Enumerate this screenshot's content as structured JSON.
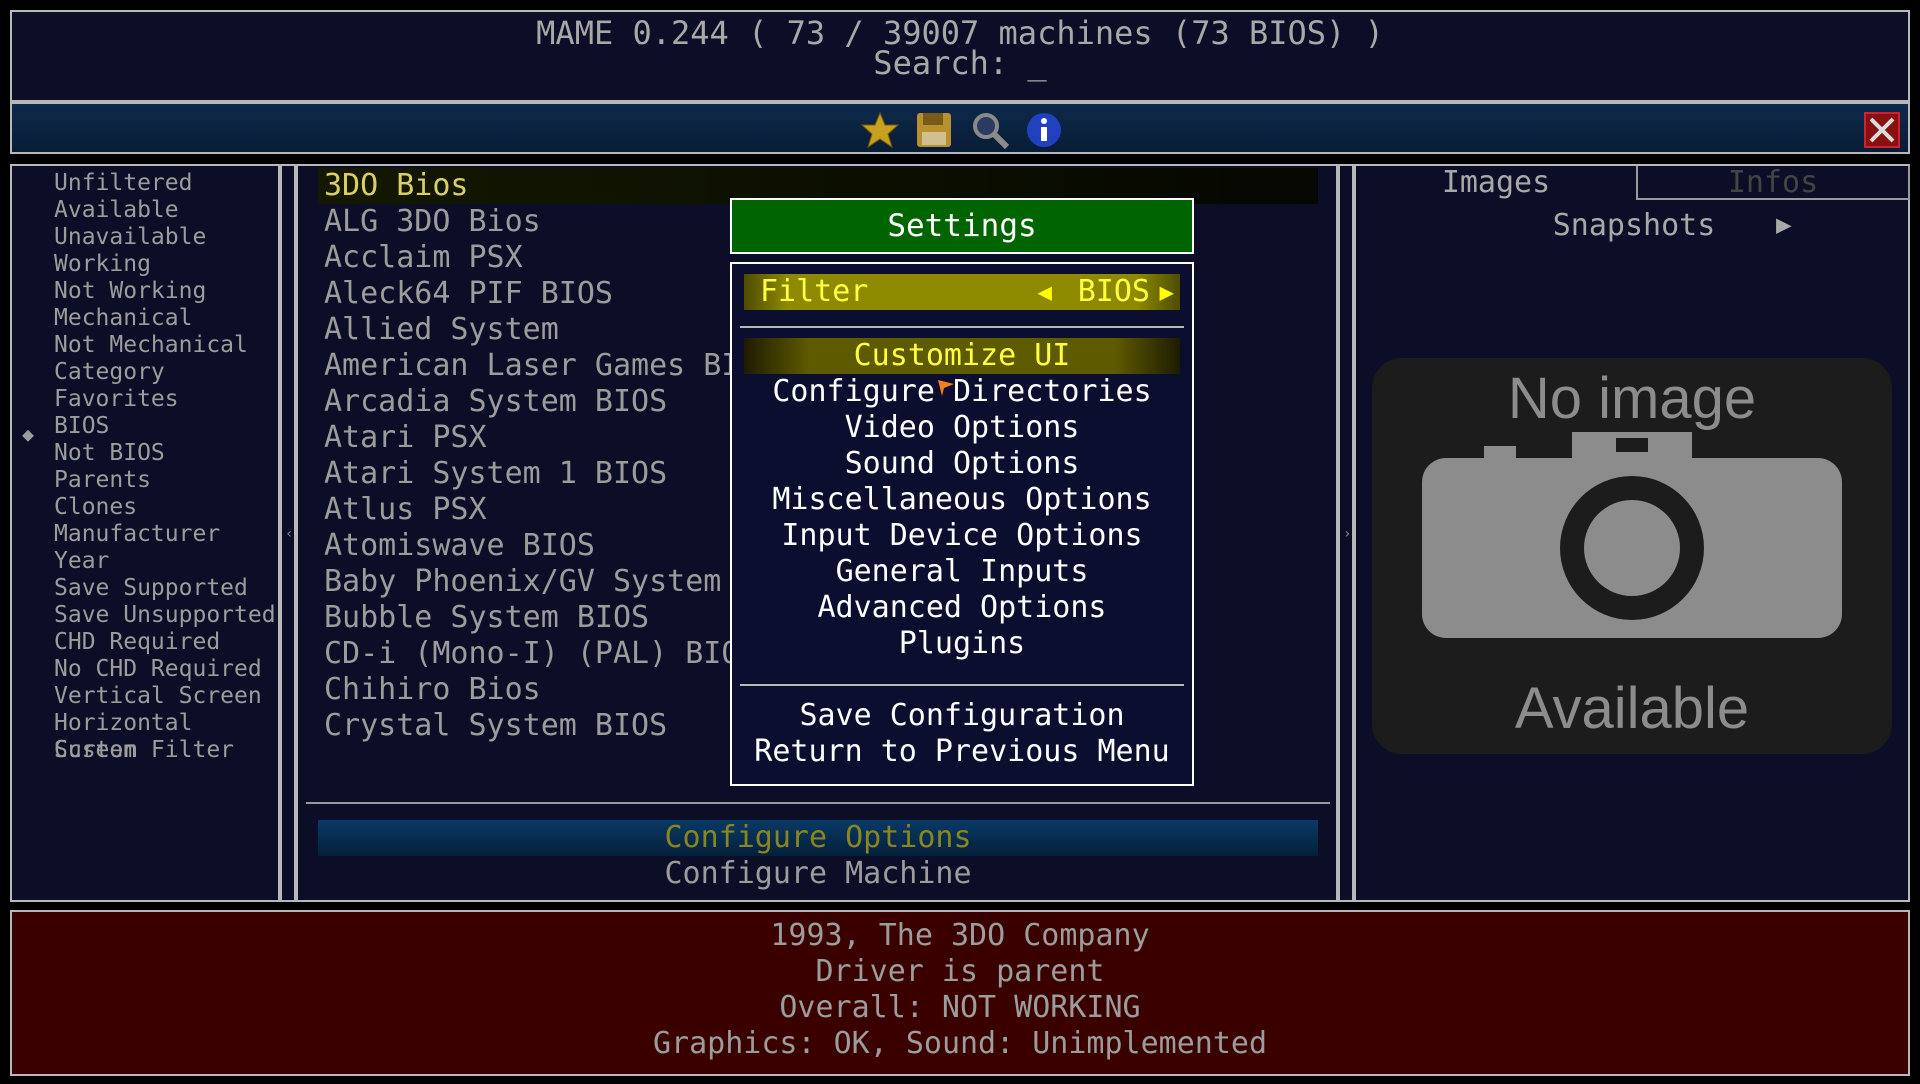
{
  "header": {
    "title": "MAME 0.244 ( 73 / 39007 machines (73 BIOS) )",
    "search": "Search: _"
  },
  "toolbar": {
    "icons": [
      "star-icon",
      "floppy-disk-icon",
      "magnifier-icon",
      "info-icon"
    ],
    "close_icon": "close-icon"
  },
  "filters": {
    "selected": "BIOS",
    "items": [
      "Unfiltered",
      "Available",
      "Unavailable",
      "Working",
      "Not Working",
      "Mechanical",
      "Not Mechanical",
      "Category",
      "Favorites",
      "BIOS",
      "Not BIOS",
      "Parents",
      "Clones",
      "Manufacturer",
      "Year",
      "Save Supported",
      "Save Unsupported",
      "CHD Required",
      "No CHD Required",
      "Vertical Screen",
      "Horizontal Screen",
      "Custom Filter"
    ]
  },
  "games": {
    "items": [
      "3DO Bios",
      "ALG 3DO Bios",
      "Acclaim PSX",
      "Aleck64 PIF BIOS",
      "Allied System",
      "American Laser Games BIOS",
      "Arcadia System BIOS",
      "Atari PSX",
      "Atari System 1 BIOS",
      "Atlus PSX",
      "Atomiswave BIOS",
      "Baby Phoenix/GV System",
      "Bubble System BIOS",
      "CD-i (Mono-I) (PAL) BIOS",
      "Chihiro Bios",
      "Crystal System BIOS"
    ],
    "selected_index": 0,
    "configure_options": "Configure Options",
    "configure_machine": "Configure Machine"
  },
  "right_panel": {
    "tab_images": "Images",
    "tab_infos": "Infos",
    "snapshots": "Snapshots",
    "noimage_line1": "No image",
    "noimage_line2": "Available"
  },
  "info": {
    "lines": [
      "1993, The 3DO Company",
      "Driver is parent",
      "Overall: NOT WORKING",
      "Graphics: OK, Sound: Unimplemented"
    ]
  },
  "settings": {
    "title": "Settings",
    "filter_label": "Filter",
    "filter_value": "BIOS",
    "items": [
      "Customize UI",
      "Configure Directories",
      "Video Options",
      "Sound Options",
      "Miscellaneous Options",
      "Input Device Options",
      "General Inputs",
      "Advanced Options",
      "Plugins"
    ],
    "save": "Save Configuration",
    "return": "Return to Previous Menu"
  },
  "colors": {
    "panel_bg": "#0b0e26",
    "info_bg": "#3a0000",
    "title_green": "#006400",
    "highlight_yellow": "#ffff40"
  }
}
